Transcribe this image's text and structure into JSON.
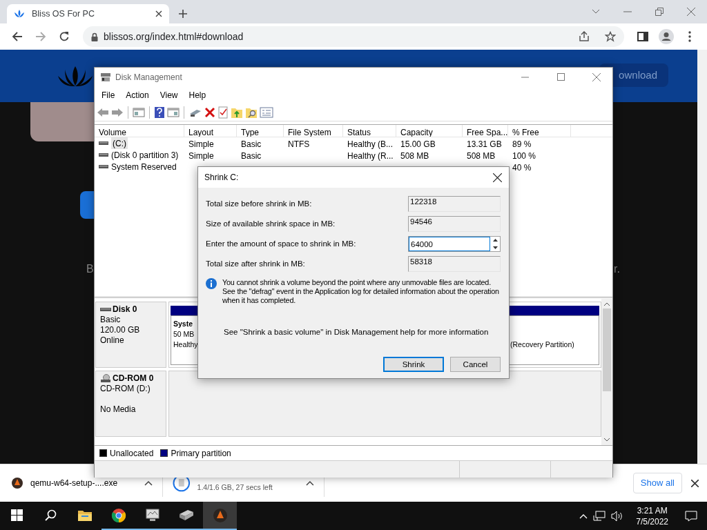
{
  "browser": {
    "tab": {
      "title": "Bliss OS For PC"
    },
    "url": "blissos.org/index.html#download"
  },
  "site": {
    "download_button": "ownload",
    "text_left": "B",
    "text_right": "r."
  },
  "disk_management": {
    "title": "Disk Management",
    "menu": [
      "File",
      "Action",
      "View",
      "Help"
    ],
    "columns": [
      "Volume",
      "Layout",
      "Type",
      "File System",
      "Status",
      "Capacity",
      "Free Spa...",
      "% Free"
    ],
    "volumes": [
      {
        "kind": "full",
        "selected": true,
        "volume": "(C:)",
        "layout": "Simple",
        "type": "Basic",
        "file_system": "NTFS",
        "status": "Healthy (B...",
        "capacity": "15.00 GB",
        "free_space": "13.31 GB",
        "pct_free": "89 %"
      },
      {
        "kind": "full",
        "selected": false,
        "volume": "(Disk 0 partition 3)",
        "layout": "Simple",
        "type": "Basic",
        "status": "Healthy (R...",
        "capacity": "508 MB",
        "free_space": "508 MB",
        "pct_free": "100 %"
      },
      {
        "kind": "covered",
        "selected": false,
        "volume": "System Reserved",
        "pct_free": "40 %"
      }
    ],
    "disks": [
      {
        "kind": "disk",
        "name": "Disk 0",
        "type": "Basic",
        "size": "120.00 GB",
        "status": "Online",
        "partitions": [
          {
            "name": "Syste",
            "lines": [
              "50 MB",
              "Healthy"
            ]
          },
          {
            "lines": [
              "(Recovery Partition)"
            ]
          }
        ]
      },
      {
        "kind": "cdrom",
        "name": "CD-ROM 0",
        "type": "CD-ROM (D:)",
        "status": "No Media"
      }
    ],
    "legend": [
      {
        "label": "Unallocated",
        "color": "#000000"
      },
      {
        "label": "Primary partition",
        "color": "#000080"
      }
    ]
  },
  "dialog": {
    "title": "Shrink C:",
    "fields": [
      {
        "kind": "readonly",
        "label": "Total size before shrink in MB:",
        "value": "122318"
      },
      {
        "kind": "readonly",
        "label": "Size of available shrink space in MB:",
        "value": "94546"
      },
      {
        "kind": "spin",
        "label": "Enter the amount of space to shrink in MB:",
        "value": "64000"
      },
      {
        "kind": "readonly",
        "label": "Total size after shrink in MB:",
        "value": "58318"
      }
    ],
    "info": "You cannot shrink a volume beyond the point where any unmovable files are located. See the \"defrag\" event in the Application log for detailed information about the operation when it has completed.",
    "help": "See \"Shrink a basic volume\" in Disk Management help for more information",
    "buttons": [
      {
        "label": "Shrink",
        "default": true
      },
      {
        "label": "Cancel",
        "default": false
      }
    ]
  },
  "downloads": {
    "items": [
      {
        "kind": "file",
        "name": "qemu-w64-setup-....exe"
      },
      {
        "kind": "progress",
        "status": "1.4/1.6 GB, 27 secs left"
      }
    ],
    "show_all": "Show all"
  },
  "taskbar": {
    "apps": [
      {
        "kind": "folder",
        "running": false,
        "selected": false
      },
      {
        "kind": "chrome",
        "running": true,
        "selected": false
      },
      {
        "kind": "monitor",
        "running": true,
        "selected": false
      },
      {
        "kind": "drive",
        "running": true,
        "selected": false
      },
      {
        "kind": "qemu",
        "running": true,
        "selected": true
      }
    ],
    "time": "3:21 AM",
    "date": "7/5/2022"
  }
}
